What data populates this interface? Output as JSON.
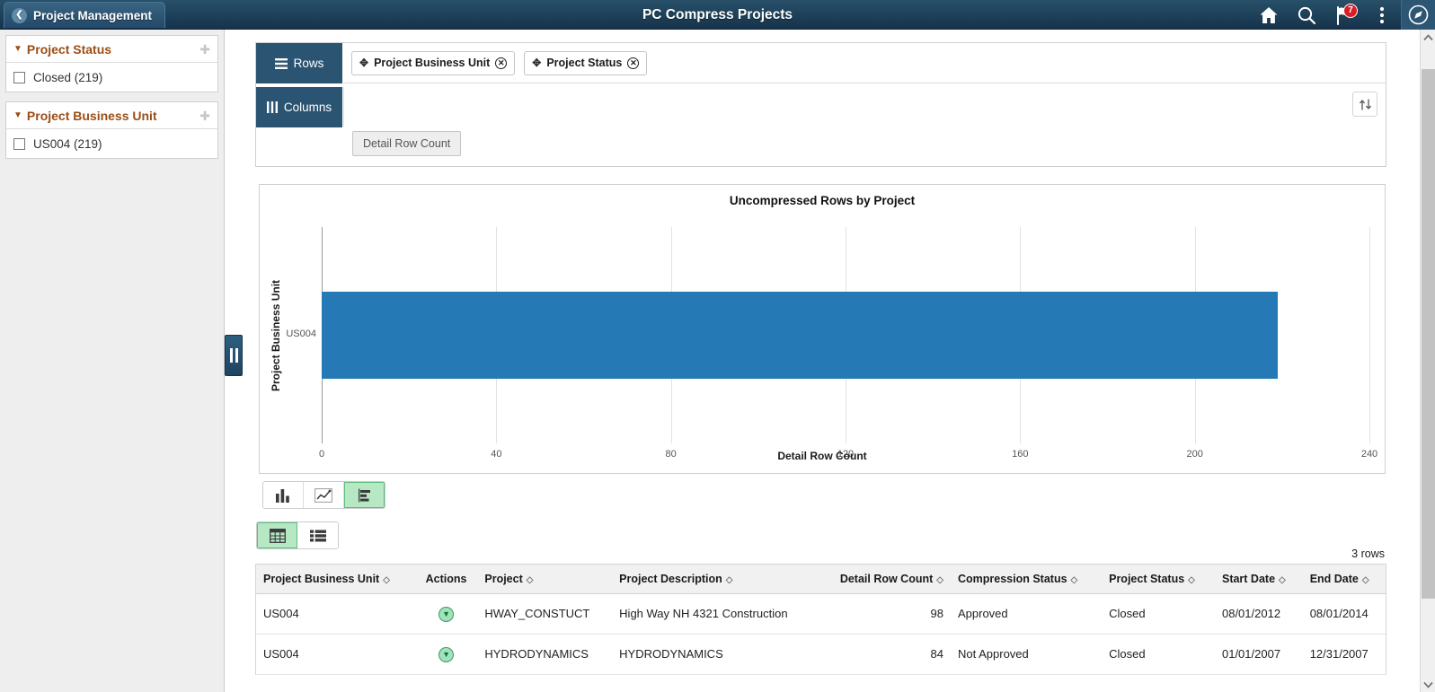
{
  "header": {
    "back_label": "Project Management",
    "back_icon": "chevron-left-icon",
    "title": "PC Compress Projects",
    "icons": [
      {
        "name": "home-icon",
        "label": "Home"
      },
      {
        "name": "search-icon",
        "label": "Search"
      },
      {
        "name": "notifications-flag-icon",
        "label": "Notifications",
        "badge": "7"
      },
      {
        "name": "actions-menu-icon",
        "label": "Actions"
      },
      {
        "name": "navbar-compass-icon",
        "label": "NavBar"
      }
    ]
  },
  "facets": [
    {
      "title": "Project Status",
      "caret": "▼",
      "move_icon": "drag-move-icon",
      "items": [
        {
          "label": "Closed (219)",
          "checked": false
        }
      ]
    },
    {
      "title": "Project Business Unit",
      "caret": "▼",
      "move_icon": "drag-move-icon",
      "items": [
        {
          "label": "US004 (219)",
          "checked": false
        }
      ]
    }
  ],
  "splitter": {
    "name": "panel-splitter-handle"
  },
  "shelf": {
    "rows_label": "Rows",
    "rows_icon": "rows-icon",
    "columns_label": "Columns",
    "columns_icon": "columns-icon",
    "row_chips": [
      {
        "label": "Project Business Unit",
        "grip": "✥",
        "remove": "✕"
      },
      {
        "label": "Project Status",
        "grip": "✥",
        "remove": "✕"
      }
    ],
    "column_chips": [],
    "measure_label": "Detail Row Count",
    "sort_icon": "sort-updown-icon"
  },
  "chart_data": {
    "type": "bar",
    "orientation": "horizontal",
    "title": "Uncompressed Rows by Project",
    "xlabel": "Detail Row Count",
    "ylabel": "Project Business Unit",
    "categories": [
      "US004"
    ],
    "values": [
      219
    ],
    "xlim": [
      0,
      240
    ],
    "xticks": [
      0,
      40,
      80,
      120,
      160,
      200,
      240
    ],
    "xtick_labels": [
      "0",
      "40",
      "80",
      "120",
      "160",
      "200",
      "240"
    ],
    "grid": true,
    "legend": false,
    "series": [
      {
        "name": "Detail Row Count",
        "values": [
          219
        ],
        "color": "#2579b4"
      }
    ]
  },
  "chart_type_toggle": {
    "options": [
      {
        "name": "vertical-bar-chart-icon",
        "label": "Bar chart",
        "active": false
      },
      {
        "name": "line-chart-icon",
        "label": "Line chart",
        "active": false
      },
      {
        "name": "horizontal-bar-chart-icon",
        "label": "Horizontal bar chart",
        "active": true
      }
    ]
  },
  "view_type_toggle": {
    "options": [
      {
        "name": "grid-view-icon",
        "label": "Grid view",
        "active": true
      },
      {
        "name": "list-view-icon",
        "label": "List view",
        "active": false
      }
    ]
  },
  "results": {
    "row_count_label": "3 rows",
    "sort_glyph": "◇",
    "columns": [
      {
        "key": "business_unit",
        "label": "Project Business Unit",
        "align": "l",
        "sortable": true
      },
      {
        "key": "actions",
        "label": "Actions",
        "align": "c",
        "sortable": false
      },
      {
        "key": "project",
        "label": "Project",
        "align": "l",
        "sortable": true
      },
      {
        "key": "description",
        "label": "Project Description",
        "align": "l",
        "sortable": true
      },
      {
        "key": "detail_row_count",
        "label": "Detail Row Count",
        "align": "r",
        "sortable": true
      },
      {
        "key": "compression_status",
        "label": "Compression Status",
        "align": "l",
        "sortable": true
      },
      {
        "key": "project_status",
        "label": "Project Status",
        "align": "l",
        "sortable": true
      },
      {
        "key": "start_date",
        "label": "Start Date",
        "align": "l",
        "sortable": true
      },
      {
        "key": "end_date",
        "label": "End Date",
        "align": "l",
        "sortable": true
      }
    ],
    "rows": [
      {
        "business_unit": "US004",
        "actions": "row-action-icon",
        "project": "HWAY_CONSTUCT",
        "description": "High Way NH 4321 Construction",
        "detail_row_count": "98",
        "compression_status": "Approved",
        "project_status": "Closed",
        "start_date": "08/01/2012",
        "end_date": "08/01/2014"
      },
      {
        "business_unit": "US004",
        "actions": "row-action-icon",
        "project": "HYDRODYNAMICS",
        "description": "HYDRODYNAMICS",
        "detail_row_count": "84",
        "compression_status": "Not Approved",
        "project_status": "Closed",
        "start_date": "01/01/2007",
        "end_date": "12/31/2007"
      }
    ]
  },
  "scrollbar": {
    "up_icon": "scroll-up-arrow-icon",
    "down_icon": "scroll-down-arrow-icon",
    "thumb": "scroll-thumb"
  },
  "colors": {
    "header_bg": "#1d4059",
    "accent_orange": "#9b4e17",
    "bar_blue": "#2579b4",
    "active_green": "#b6e8c4",
    "badge_red": "#d81f26"
  }
}
